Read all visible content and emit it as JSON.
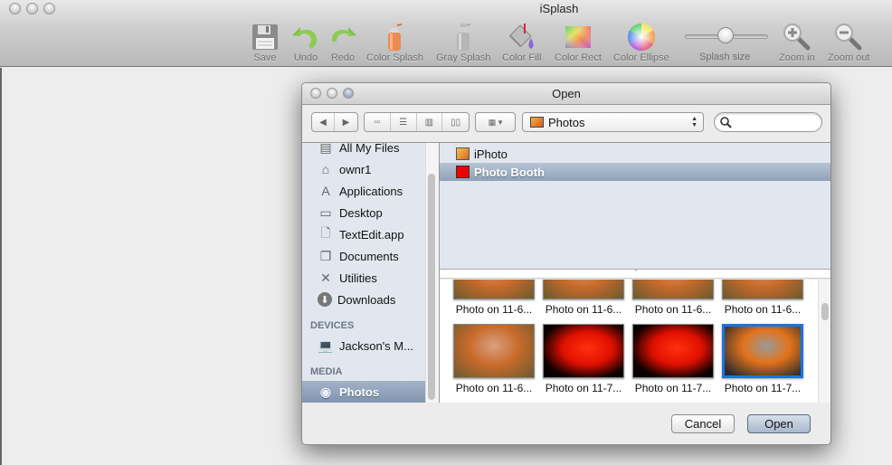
{
  "app": {
    "title": "iSplash",
    "toolbar": [
      {
        "id": "save",
        "label": "Save",
        "icon": "floppy-disk-icon"
      },
      {
        "id": "undo",
        "label": "Undo",
        "icon": "undo-arrow-icon"
      },
      {
        "id": "redo",
        "label": "Redo",
        "icon": "redo-arrow-icon"
      },
      {
        "id": "color-splash",
        "label": "Color Splash",
        "icon": "spray-can-color-icon"
      },
      {
        "id": "gray-splash",
        "label": "Gray Splash",
        "icon": "spray-can-gray-icon"
      },
      {
        "id": "color-fill",
        "label": "Color Fill",
        "icon": "paint-bucket-icon"
      },
      {
        "id": "color-rect",
        "label": "Color Rect",
        "icon": "color-rect-icon"
      },
      {
        "id": "color-ellipse",
        "label": "Color Ellipse",
        "icon": "color-wheel-icon"
      },
      {
        "id": "zoom-in",
        "label": "Zoom in",
        "icon": "zoom-in-icon"
      },
      {
        "id": "zoom-out",
        "label": "Zoom out",
        "icon": "zoom-out-icon"
      }
    ],
    "splash_size": {
      "label": "Splash size",
      "value": 0.5
    }
  },
  "dialog": {
    "title": "Open",
    "location": "Photos",
    "search_placeholder": "",
    "sidebar": {
      "favorites": [
        {
          "label": "All My Files",
          "icon": "all-files-icon"
        },
        {
          "label": "ownr1",
          "icon": "home-icon"
        },
        {
          "label": "Applications",
          "icon": "applications-icon"
        },
        {
          "label": "Desktop",
          "icon": "desktop-icon"
        },
        {
          "label": "TextEdit.app",
          "icon": "document-icon"
        },
        {
          "label": "Documents",
          "icon": "documents-icon"
        },
        {
          "label": "Utilities",
          "icon": "utilities-icon"
        },
        {
          "label": "Downloads",
          "icon": "downloads-icon"
        }
      ],
      "devices_heading": "DEVICES",
      "devices": [
        {
          "label": "Jackson's M...",
          "icon": "laptop-icon"
        }
      ],
      "media_heading": "MEDIA",
      "media": [
        {
          "label": "Photos",
          "icon": "camera-icon",
          "selected": true
        }
      ]
    },
    "sources": [
      {
        "label": "iPhoto",
        "icon": "iphoto-icon",
        "selected": false
      },
      {
        "label": "Photo Booth",
        "icon": "photo-booth-icon",
        "selected": true
      }
    ],
    "photos": [
      {
        "caption": "Photo on 11-6...",
        "tone": "orange",
        "selected": false
      },
      {
        "caption": "Photo on 11-6...",
        "tone": "orange",
        "selected": false
      },
      {
        "caption": "Photo on 11-6...",
        "tone": "orange",
        "selected": false
      },
      {
        "caption": "Photo on 11-6...",
        "tone": "orange",
        "selected": false
      },
      {
        "caption": "Photo on 11-6...",
        "tone": "orange",
        "selected": false
      },
      {
        "caption": "Photo on 11-7...",
        "tone": "red",
        "selected": false
      },
      {
        "caption": "Photo on 11-7...",
        "tone": "red",
        "selected": false
      },
      {
        "caption": "Photo on 11-7...",
        "tone": "orange-gray",
        "selected": true
      }
    ],
    "buttons": {
      "cancel": "Cancel",
      "open": "Open"
    }
  },
  "colors": {
    "selection_blue": "#1a73e8",
    "sidebar_bg": "#e2e7ef"
  }
}
